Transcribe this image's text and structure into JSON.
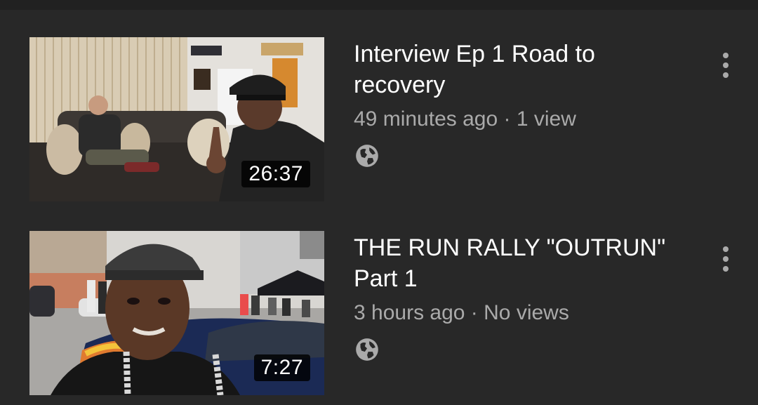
{
  "videos": [
    {
      "title": "Interview Ep 1 Road to recovery",
      "age": "49 minutes ago",
      "separator": "·",
      "views": "1 view",
      "duration": "26:37",
      "visibility_icon": "globe-icon",
      "menu_icon": "more-vert-icon"
    },
    {
      "title": "THE RUN RALLY \"OUTRUN\" Part 1",
      "age": "3 hours ago",
      "separator": "·",
      "views": "No views",
      "duration": "7:27",
      "visibility_icon": "globe-icon",
      "menu_icon": "more-vert-icon"
    }
  ],
  "colors": {
    "background": "#282828",
    "title_text": "#ffffff",
    "meta_text": "#aaaaaa",
    "duration_badge": "#000000"
  }
}
